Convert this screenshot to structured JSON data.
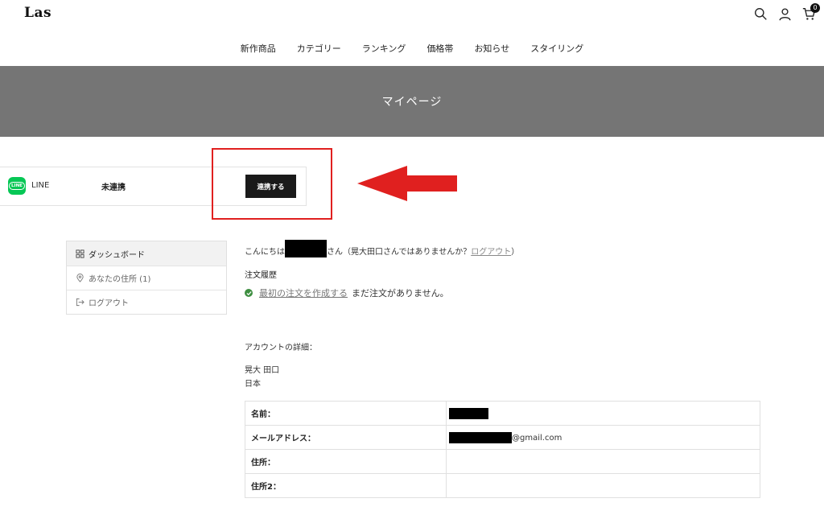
{
  "header": {
    "logo": "Las",
    "cart_count": "0",
    "icons": [
      "search-icon",
      "user-icon",
      "cart-icon"
    ]
  },
  "nav": {
    "items": [
      "新作商品",
      "カテゴリー",
      "ランキング",
      "価格帯",
      "お知らせ",
      "スタイリング"
    ]
  },
  "banner": {
    "title": "マイページ"
  },
  "line_connect": {
    "logo_text": "LINE",
    "label": "LINE",
    "status": "未連携",
    "button_label": "連携する"
  },
  "annotation": {
    "highlight_color": "#e0201f"
  },
  "sidebar": {
    "items": [
      {
        "label": "ダッシュボード",
        "icon": "grid-icon"
      },
      {
        "label": "あなたの住所 (1)",
        "icon": "location-pin-icon"
      },
      {
        "label": "ログアウト",
        "icon": "logout-icon"
      }
    ]
  },
  "main": {
    "greeting_prefix": "こんにちは",
    "greeting_mid": "さん（晃大田口さんではありませんか？",
    "greeting_logout": "ログアウト",
    "greeting_suffix": "）",
    "orders_heading": "注文履歴",
    "create_order_link": "最初の注文を作成する",
    "no_orders_text": "まだ注文がありません。",
    "account_heading": "アカウントの詳細：",
    "full_name": "晃大 田口",
    "country": "日本",
    "details": [
      {
        "label": "名前：",
        "value": ""
      },
      {
        "label": "メールアドレス：",
        "value": "@gmail.com"
      },
      {
        "label": "住所：",
        "value": ""
      },
      {
        "label": "住所2：",
        "value": ""
      }
    ]
  }
}
